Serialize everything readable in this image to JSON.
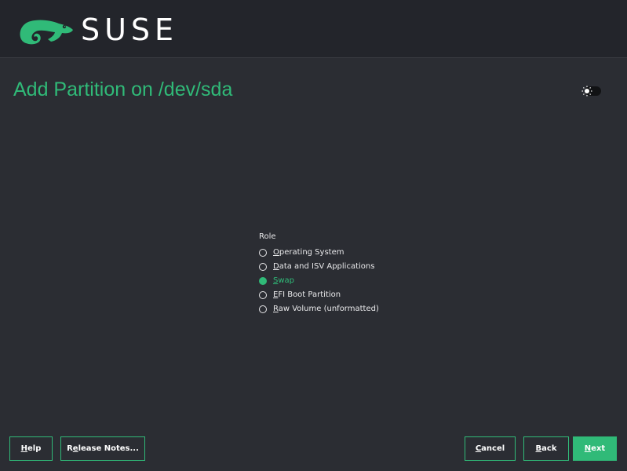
{
  "brand": {
    "name": "SUSE",
    "accent_color": "#30ba78",
    "logo_icon": "chameleon-icon"
  },
  "page": {
    "title": "Add Partition on /dev/sda"
  },
  "theme_toggle": {
    "icon": "sun-icon"
  },
  "role": {
    "label": "Role",
    "selected": "Swap",
    "options": [
      {
        "mnemonic": "O",
        "rest": "perating System",
        "checked": false
      },
      {
        "mnemonic": "D",
        "rest": "ata and ISV Applications",
        "checked": false
      },
      {
        "mnemonic": "S",
        "rest": "wap",
        "checked": true
      },
      {
        "mnemonic": "E",
        "rest": "FI Boot Partition",
        "checked": false
      },
      {
        "mnemonic": "R",
        "rest": "aw Volume (unformatted)",
        "checked": false
      }
    ]
  },
  "buttons": {
    "help": {
      "mnemonic": "H",
      "rest": "elp"
    },
    "release_notes": {
      "mnemonic": "e",
      "prefix": "R",
      "rest": "lease Notes..."
    },
    "cancel": {
      "mnemonic": "C",
      "rest": "ancel"
    },
    "back": {
      "mnemonic": "B",
      "rest": "ack"
    },
    "next": {
      "mnemonic": "N",
      "rest": "ext"
    }
  }
}
